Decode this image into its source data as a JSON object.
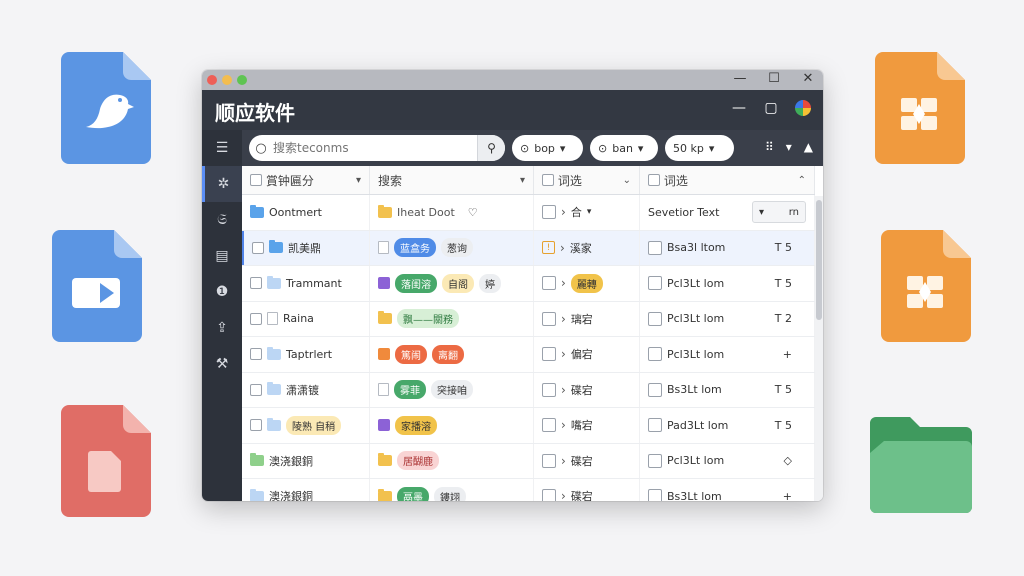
{
  "window": {
    "title": "顺应软件",
    "controls": [
      "—",
      "☐",
      "✕"
    ]
  },
  "header_icons": [
    "minimize-icon",
    "screen-icon",
    "color-wheel-icon"
  ],
  "sidebar": {
    "items": [
      {
        "icon": "menu-icon",
        "glyph": "☰"
      },
      {
        "icon": "sparkle-icon",
        "glyph": "✲"
      },
      {
        "icon": "puzzle-icon",
        "glyph": "𝔖"
      },
      {
        "icon": "document-icon",
        "glyph": "▤"
      },
      {
        "icon": "info-icon",
        "glyph": "❶"
      },
      {
        "icon": "upload-icon",
        "glyph": "⇪"
      },
      {
        "icon": "tools-icon",
        "glyph": "⚒"
      }
    ]
  },
  "toolbar": {
    "search_placeholder": "搜索teconms",
    "pill_1": "bop",
    "pill_2": "ban",
    "pill_3": "50 kp"
  },
  "table": {
    "headers": [
      "賞钟匾分",
      "搜索",
      "词选",
      "词选"
    ],
    "rows": [
      {
        "c1": "Oontmert",
        "c2": "Iheat Doot",
        "c3": "合",
        "c4": "Sevetior Text",
        "c4v": "rn"
      },
      {
        "c1": "凯美鼎",
        "c2a": "蓝盒务",
        "c2b": "葱询",
        "c3": "溪家",
        "c4": "Bsa3l ltom",
        "c4v": "T 5"
      },
      {
        "c1": "Trammant",
        "c2a": "落闺溶",
        "c2b": "自阁",
        "c2c": "婷",
        "c3": "麗轉",
        "c4": "Pcl3Lt lom",
        "c4v": "T 5"
      },
      {
        "c1": "Raina",
        "c2a": "飘——關務",
        "c3": "璃宕",
        "c4": "Pcl3Lt lom",
        "c4v": "T 2"
      },
      {
        "c1": "Taptrlert",
        "c2a": "篤闹",
        "c2b": "离翻",
        "c3": "偏宕",
        "c4": "Pcl3Lt lom",
        "c4v": "+"
      },
      {
        "c1": "潇潇镀",
        "c2a": "雾菲",
        "c2b": "突接咱",
        "c3": "碟宕",
        "c4": "Bs3Lt lom",
        "c4v": "T 5"
      },
      {
        "c1": "陵熟 自稍",
        "c2a": "家播溶",
        "c3": "嘴宕",
        "c4": "Pad3Lt lom",
        "c4v": "T 5"
      },
      {
        "c1": "澳浇銀銅",
        "c2a": "居醐鹿",
        "c3": "碟宕",
        "c4": "Pcl3Lt lom",
        "c4v": "◇"
      },
      {
        "c1": "澳浇銀銅",
        "c2a": "鬲墨",
        "c2b": "鏤翊",
        "c3": "碟宕",
        "c4": "Bs3Lt lom",
        "c4v": "+"
      }
    ]
  }
}
